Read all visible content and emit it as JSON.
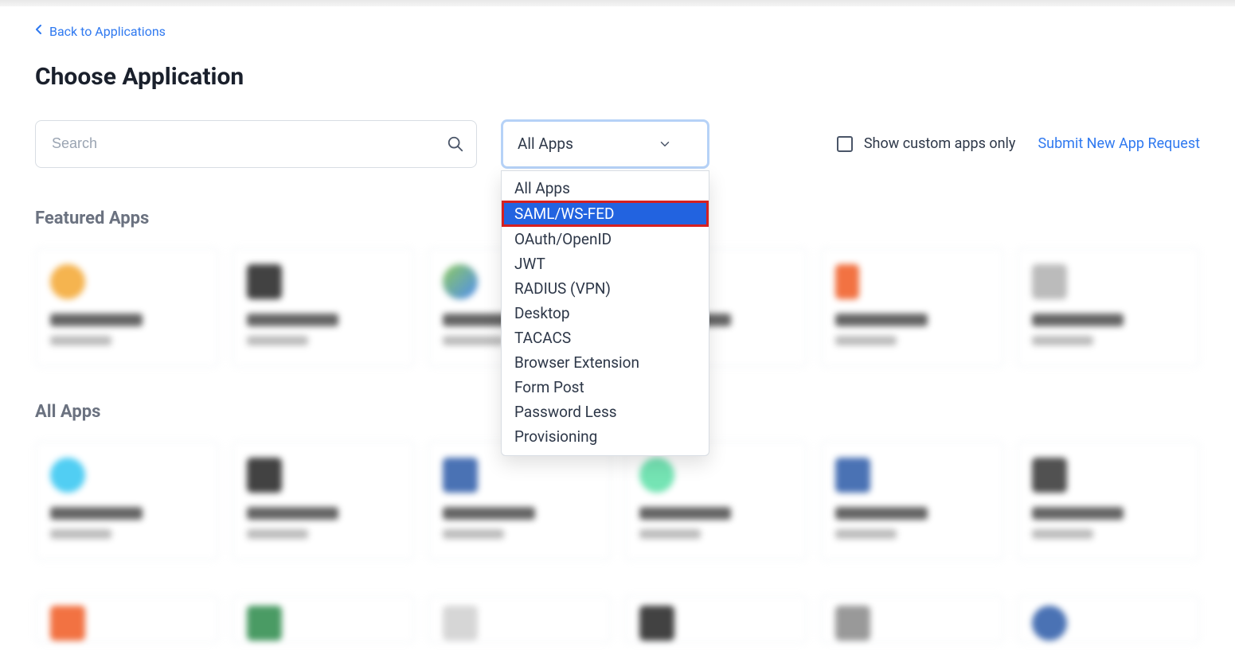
{
  "nav": {
    "back_label": "Back to Applications"
  },
  "page": {
    "title": "Choose Application"
  },
  "search": {
    "placeholder": "Search"
  },
  "filter": {
    "selected": "All Apps",
    "options": [
      "All Apps",
      "SAML/WS-FED",
      "OAuth/OpenID",
      "JWT",
      "RADIUS (VPN)",
      "Desktop",
      "TACACS",
      "Browser Extension",
      "Form Post",
      "Password Less",
      "Provisioning"
    ],
    "highlighted_index": 1
  },
  "right": {
    "checkbox_label": "Show custom apps only",
    "submit_label": "Submit New App Request"
  },
  "sections": {
    "featured_title": "Featured Apps",
    "all_title": "All Apps"
  }
}
